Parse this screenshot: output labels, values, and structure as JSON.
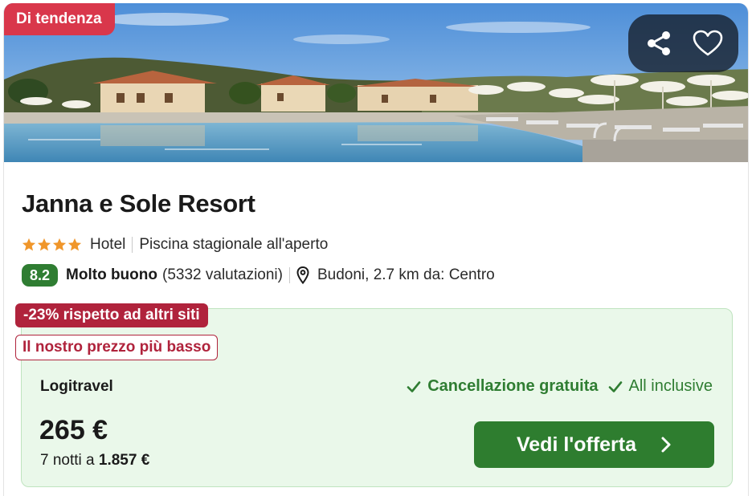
{
  "hero": {
    "badge": "Di tendenza",
    "share_icon": "share-icon",
    "favorite_icon": "heart-outline-icon"
  },
  "hotel": {
    "name": "Janna e Sole Resort",
    "stars": 4,
    "star_color": "#f0962a",
    "type": "Hotel",
    "amenity": "Piscina stagionale all'aperto",
    "score": "8.2",
    "score_label": "Molto buono",
    "reviews": "(5332 valutazioni)",
    "location": "Budoni, 2.7 km da: Centro"
  },
  "offer": {
    "discount_tag": "-23% rispetto ad altri siti",
    "lowest_tag": "Il nostro prezzo più basso",
    "provider": "Logitravel",
    "feature_1": "Cancellazione gratuita",
    "feature_2": "All inclusive",
    "price": "265 €",
    "total_prefix": "7 notti a",
    "total_value": "1.857 €",
    "cta_label": "Vedi l'offerta"
  },
  "colors": {
    "badge": "#d9374b",
    "score_green": "#2f7d32",
    "cta_green": "#2e7d2f",
    "discount_red": "#b0233c",
    "offer_bg": "#eaf8ea"
  }
}
